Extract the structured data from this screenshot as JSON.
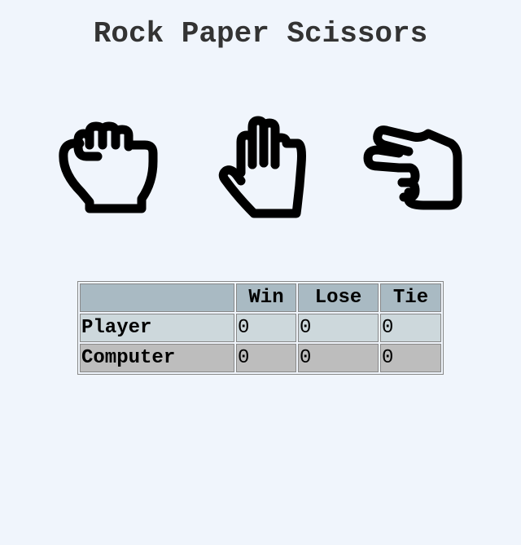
{
  "title": "Rock Paper Scissors",
  "choices": [
    {
      "id": "rock",
      "icon": "rock-icon"
    },
    {
      "id": "paper",
      "icon": "paper-icon"
    },
    {
      "id": "scissors",
      "icon": "scissors-icon"
    }
  ],
  "scoreboard": {
    "headers": [
      "",
      "Win",
      "Lose",
      "Tie"
    ],
    "rows": [
      {
        "label": "Player",
        "win": "0",
        "lose": "0",
        "tie": "0"
      },
      {
        "label": "Computer",
        "win": "0",
        "lose": "0",
        "tie": "0"
      }
    ]
  },
  "colors": {
    "background": "#f0f5fc",
    "header_bg": "#a9bac3",
    "player_row_bg": "#cdd8dc",
    "computer_row_bg": "#bdbdbd"
  }
}
